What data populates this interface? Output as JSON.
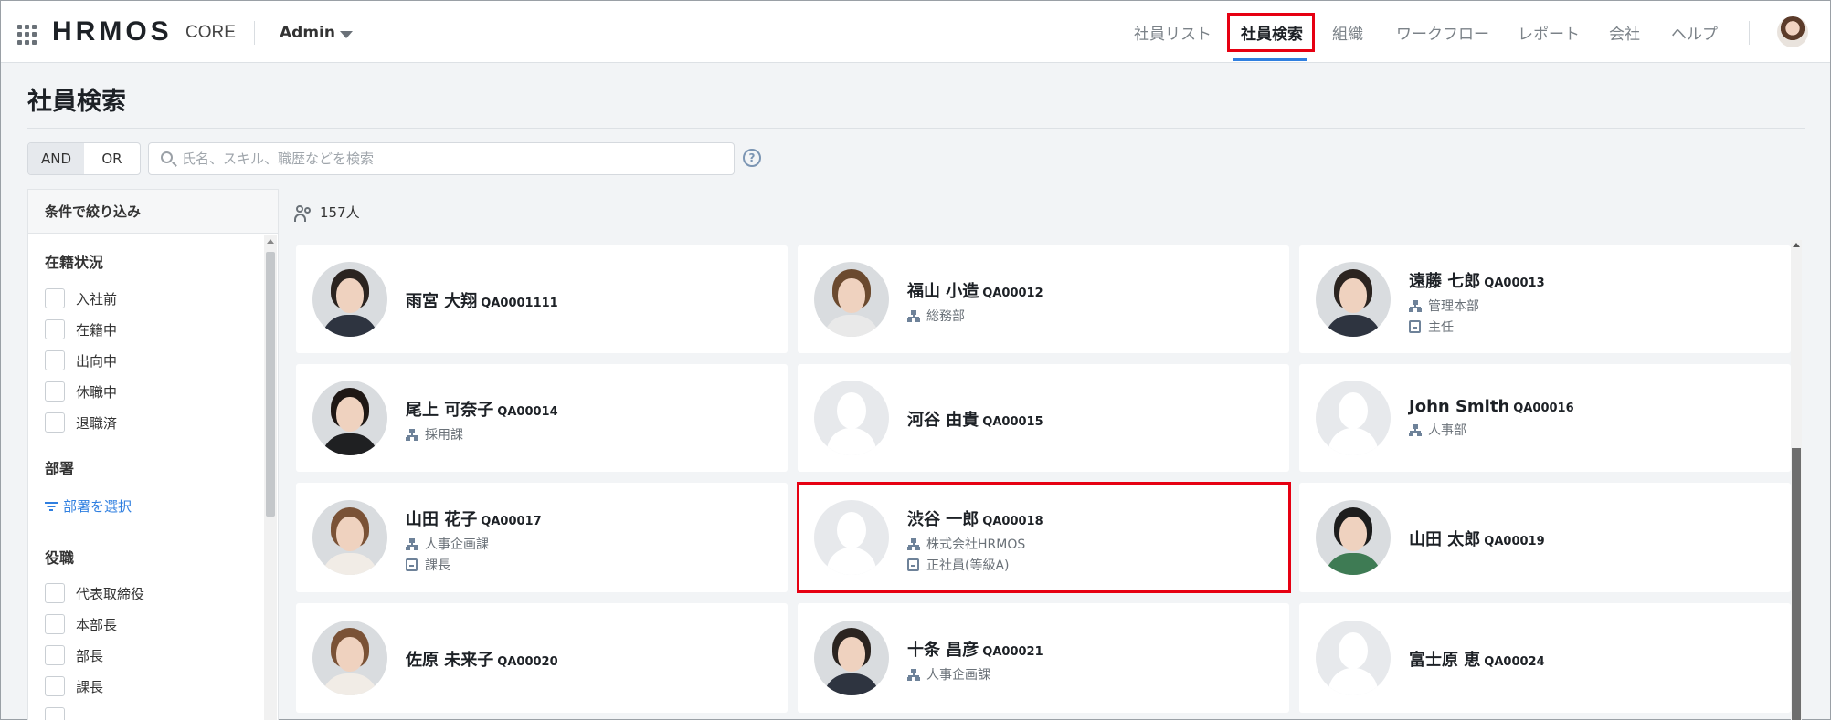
{
  "app": {
    "logo": "HRMOS",
    "product": "CORE",
    "role": "Admin"
  },
  "nav": [
    {
      "label": "社員リスト",
      "active": false
    },
    {
      "label": "社員検索",
      "active": true
    },
    {
      "label": "組織",
      "active": false
    },
    {
      "label": "ワークフロー",
      "active": false
    },
    {
      "label": "レポート",
      "active": false
    },
    {
      "label": "会社",
      "active": false
    },
    {
      "label": "ヘルプ",
      "active": false
    }
  ],
  "page": {
    "title": "社員検索"
  },
  "search": {
    "and_label": "AND",
    "or_label": "OR",
    "active_mode": "AND",
    "placeholder": "氏名、スキル、職歴などを検索",
    "value": "",
    "help": "?"
  },
  "sidebar": {
    "header": "条件で絞り込み",
    "status": {
      "title": "在籍状況",
      "options": [
        "入社前",
        "在籍中",
        "出向中",
        "休職中",
        "退職済"
      ]
    },
    "department": {
      "title": "部署",
      "select_link": "部署を選択"
    },
    "position": {
      "title": "役職",
      "options": [
        "代表取締役",
        "本部長",
        "部長",
        "課長"
      ]
    }
  },
  "results": {
    "count": "157人",
    "employees": [
      {
        "name": "雨宮 大翔",
        "code": "QA0001111",
        "dept": "",
        "role": "",
        "avatar": "photo-man-suit"
      },
      {
        "name": "福山 小造",
        "code": "QA00012",
        "dept": "総務部",
        "role": "",
        "avatar": "photo-man-young"
      },
      {
        "name": "遠藤 七郎",
        "code": "QA00013",
        "dept": "管理本部",
        "role": "主任",
        "avatar": "photo-man-suit"
      },
      {
        "name": "尾上 可奈子",
        "code": "QA00014",
        "dept": "採用課",
        "role": "",
        "avatar": "photo-woman-dark"
      },
      {
        "name": "河谷 由貴",
        "code": "QA00015",
        "dept": "",
        "role": "",
        "avatar": "placeholder"
      },
      {
        "name": "John Smith",
        "code": "QA00016",
        "dept": "人事部",
        "role": "",
        "avatar": "placeholder"
      },
      {
        "name": "山田 花子",
        "code": "QA00017",
        "dept": "人事企画課",
        "role": "課長",
        "avatar": "photo-woman-light"
      },
      {
        "name": "渋谷 一郎",
        "code": "QA00018",
        "dept": "株式会社HRMOS",
        "role": "正社員(等級A)",
        "avatar": "placeholder"
      },
      {
        "name": "山田 太郎",
        "code": "QA00019",
        "dept": "",
        "role": "",
        "avatar": "photo-man-green"
      },
      {
        "name": "佐原 未来子",
        "code": "QA00020",
        "dept": "",
        "role": "",
        "avatar": "photo-woman-light"
      },
      {
        "name": "十条 昌彦",
        "code": "QA00021",
        "dept": "人事企画課",
        "role": "",
        "avatar": "photo-man-suit"
      },
      {
        "name": "富士原 恵",
        "code": "QA00024",
        "dept": "",
        "role": "",
        "avatar": "placeholder"
      }
    ]
  },
  "colors": {
    "accent": "#2f7fe0",
    "highlight": "#e60012",
    "icon": "#6e8299"
  }
}
